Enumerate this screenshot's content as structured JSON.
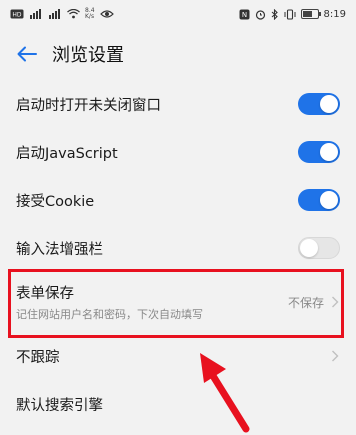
{
  "status_bar": {
    "net_speed_top": "8.4",
    "net_speed_bottom": "K/s",
    "time": "8:19"
  },
  "header": {
    "title": "浏览设置"
  },
  "settings": {
    "open_unclosed_windows": {
      "label": "启动时打开未关闭窗口",
      "enabled": true
    },
    "javascript": {
      "label": "启动JavaScript",
      "enabled": true
    },
    "cookie": {
      "label": "接受Cookie",
      "enabled": true
    },
    "ime_bar": {
      "label": "输入法增强栏",
      "enabled": false
    },
    "form_save": {
      "label": "表单保存",
      "description": "记住网站用户名和密码，下次自动填写",
      "value": "不保存"
    },
    "do_not_track": {
      "label": "不跟踪"
    },
    "default_search": {
      "label": "默认搜索引擎"
    }
  },
  "colors": {
    "accent": "#1f73e8",
    "highlight": "#e8111f"
  }
}
